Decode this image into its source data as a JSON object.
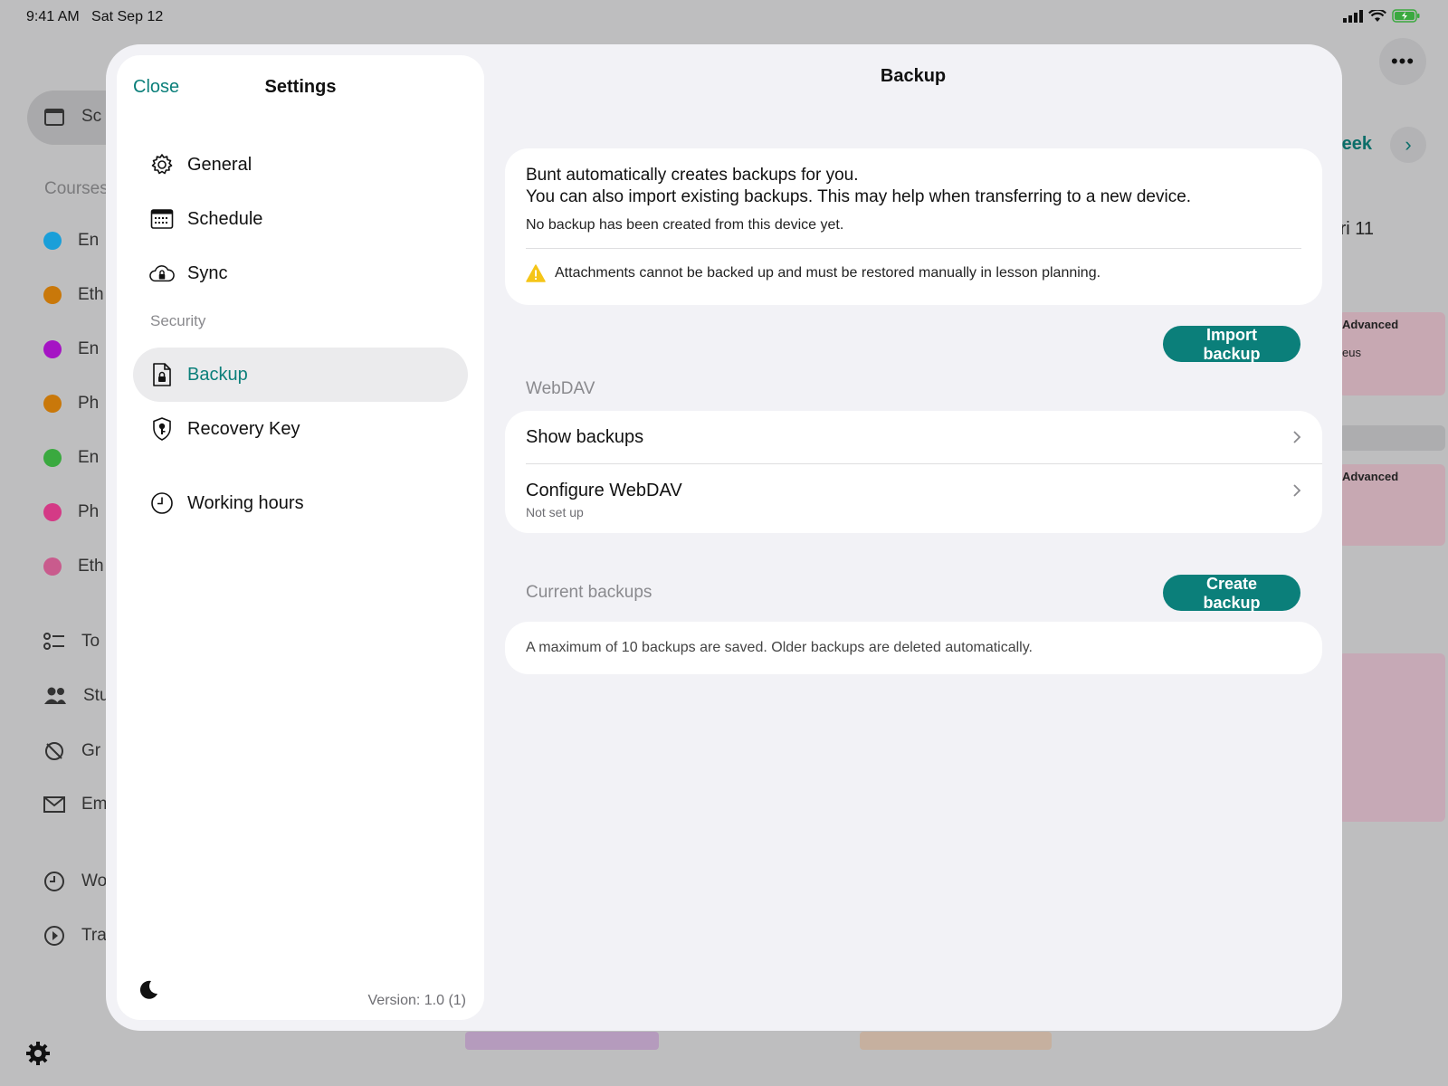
{
  "status_bar": {
    "time": "9:41 AM",
    "date": "Sat Sep 12"
  },
  "background": {
    "sidebar_items": [
      {
        "label": "Sc",
        "icon": "calendar-icon"
      },
      {
        "label": "En",
        "color": "#1a9fd9"
      },
      {
        "label": "Eth",
        "color": "#c9780a"
      },
      {
        "label": "En",
        "color": "#a514c4"
      },
      {
        "label": "Ph",
        "color": "#c9780a"
      },
      {
        "label": "En",
        "color": "#3aa93f"
      },
      {
        "label": "Ph",
        "color": "#d43a86"
      },
      {
        "label": "Eth",
        "color": "#c95b8d"
      },
      {
        "label": "To",
        "icon": "checklist-icon"
      },
      {
        "label": "Stu",
        "icon": "people-icon"
      },
      {
        "label": "Gr",
        "icon": "grades-icon"
      },
      {
        "label": "Em",
        "icon": "mail-icon"
      },
      {
        "label": "Wo",
        "icon": "clock-icon"
      },
      {
        "label": "Tra",
        "icon": "play-icon"
      }
    ],
    "courses_label": "Courses",
    "week_label": "eek",
    "fri_label": "ri 11",
    "events": [
      {
        "title": "Advanced",
        "sub": "eus"
      },
      {
        "title": "Advanced",
        "sub": ""
      }
    ]
  },
  "settings": {
    "close_label": "Close",
    "title": "Settings",
    "nav": [
      {
        "label": "General",
        "icon": "gear-icon"
      },
      {
        "label": "Schedule",
        "icon": "calendar-icon"
      },
      {
        "label": "Sync",
        "icon": "cloud-lock-icon"
      }
    ],
    "security_label": "Security",
    "security_nav": [
      {
        "label": "Backup",
        "icon": "document-lock-icon",
        "active": true
      },
      {
        "label": "Recovery Key",
        "icon": "shield-key-icon"
      }
    ],
    "other_nav": [
      {
        "label": "Working hours",
        "icon": "clock-icon"
      }
    ],
    "version": "Version: 1.0 (1)"
  },
  "backup": {
    "title": "Backup",
    "info_line1": "Bunt automatically creates backups for you.",
    "info_line2": "You can also import existing backups. This may help when transferring to a new device.",
    "info_line3": "No backup has been created from this device yet.",
    "warning": "Attachments cannot be backed up and must be restored manually in lesson planning.",
    "import_button": "Import backup",
    "webdav_label": "WebDAV",
    "show_backups": "Show backups",
    "configure_webdav": "Configure WebDAV",
    "configure_status": "Not set up",
    "current_label": "Current backups",
    "create_button": "Create backup",
    "max_note": "A maximum of 10 backups are saved. Older backups are deleted automatically."
  },
  "colors": {
    "accent": "#0b7f7a",
    "warning": "#f5c518"
  }
}
